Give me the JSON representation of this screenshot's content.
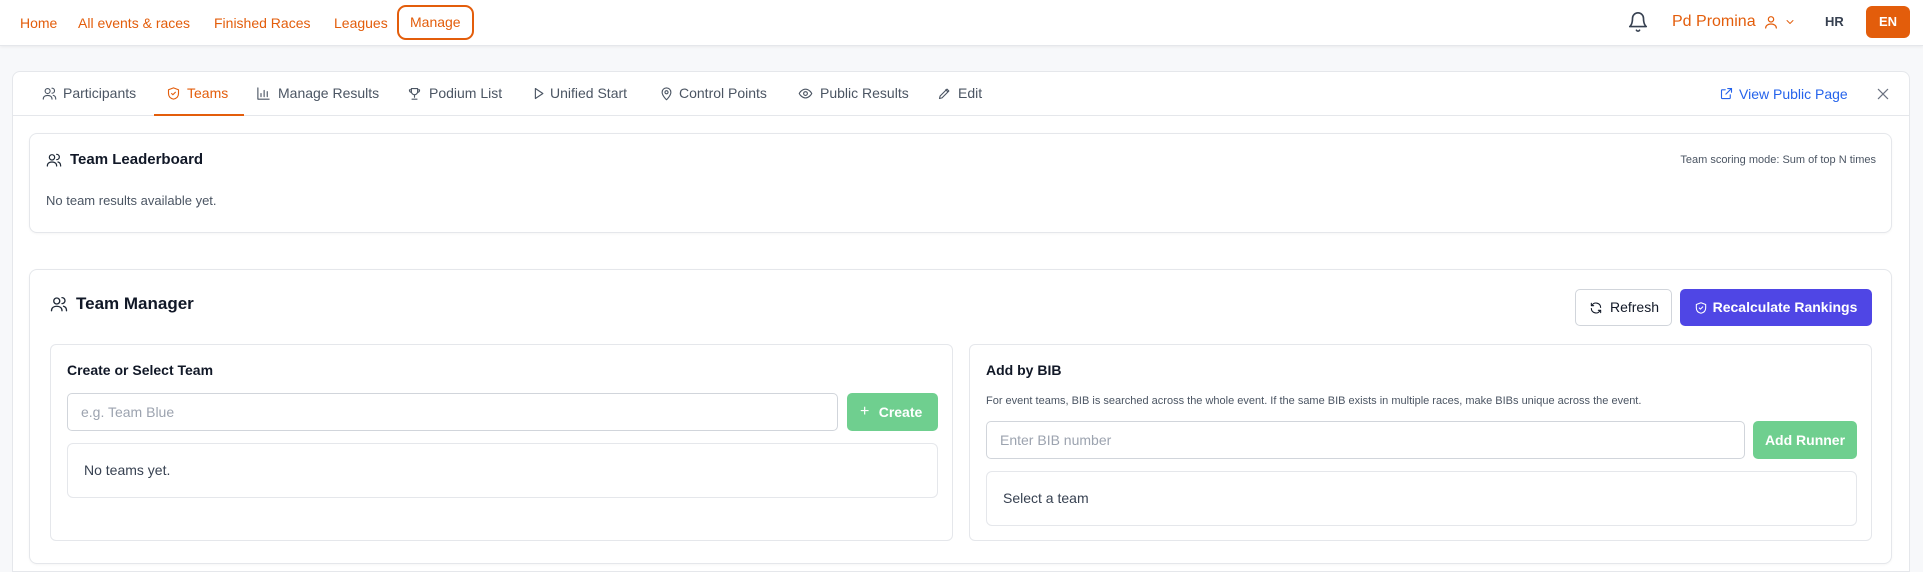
{
  "nav": {
    "links": [
      "Home",
      "All events & races",
      "Finished Races",
      "Leagues",
      "Manage"
    ],
    "user_name": "Pd Promina",
    "lang_hr": "HR",
    "lang_en": "EN"
  },
  "tabs": {
    "items": [
      "Participants",
      "Teams",
      "Manage Results",
      "Podium List",
      "Unified Start",
      "Control Points",
      "Public Results",
      "Edit"
    ],
    "active": "Teams",
    "view_public": "View Public Page"
  },
  "leaderboard": {
    "title": "Team Leaderboard",
    "scoring_mode": "Team scoring mode: Sum of top N times",
    "empty": "No team results available yet."
  },
  "manager": {
    "title": "Team Manager",
    "refresh_label": "Refresh",
    "recalc_label": "Recalculate Rankings",
    "create": {
      "title": "Create or Select Team",
      "placeholder": "e.g. Team Blue",
      "value": "",
      "button": "Create",
      "empty": "No teams yet."
    },
    "bib": {
      "title": "Add by BIB",
      "help": "For event teams, BIB is searched across the whole event. If the same BIB exists in multiple races, make BIBs unique across the event.",
      "placeholder": "Enter BIB number",
      "value": "",
      "button": "Add Runner",
      "select_team": "Select a team"
    }
  },
  "colors": {
    "accent": "#e35d0b",
    "link_blue": "#2563eb",
    "primary_button": "#4f46e5",
    "create_button": "#6fcf8f"
  }
}
